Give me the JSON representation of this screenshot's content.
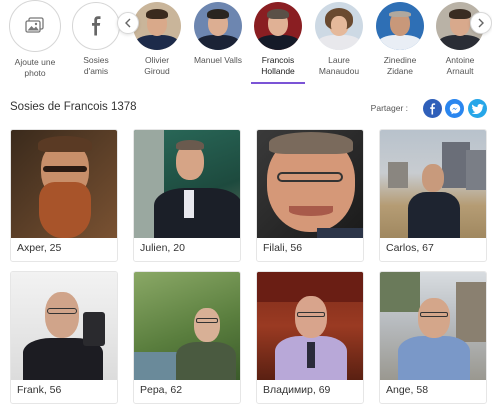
{
  "carousel": {
    "add_photo": {
      "icon": "image-icon",
      "lines": [
        "Ajoute une",
        "photo"
      ]
    },
    "friends": {
      "icon": "facebook-icon",
      "lines": [
        "Sosies",
        "d'amis"
      ]
    },
    "people": [
      {
        "lines": [
          "Olivier",
          "Giroud"
        ]
      },
      {
        "lines": [
          "Manuel Valls",
          ""
        ]
      },
      {
        "lines": [
          "Francois",
          "Hollande"
        ],
        "active": true
      },
      {
        "lines": [
          "Laure",
          "Manaudou"
        ]
      },
      {
        "lines": [
          "Zinedine",
          "Zidane"
        ]
      },
      {
        "lines": [
          "Antoine",
          "Arnault"
        ]
      }
    ],
    "prev_icon": "chevron-left-icon",
    "next_icon": "chevron-right-icon",
    "accent_color": "#7b54d6"
  },
  "section": {
    "title": "Sosies de Francois 1378",
    "share_label": "Partager :",
    "share_icons": [
      "facebook-icon",
      "messenger-icon",
      "twitter-icon"
    ]
  },
  "results": [
    {
      "caption": "Axper, 25"
    },
    {
      "caption": "Julien, 20"
    },
    {
      "caption": "Filali, 56"
    },
    {
      "caption": "Carlos, 67"
    },
    {
      "caption": "Frank, 56"
    },
    {
      "caption": "Pepa, 62"
    },
    {
      "caption": "Владимир, 69"
    },
    {
      "caption": "Ange, 58"
    }
  ]
}
